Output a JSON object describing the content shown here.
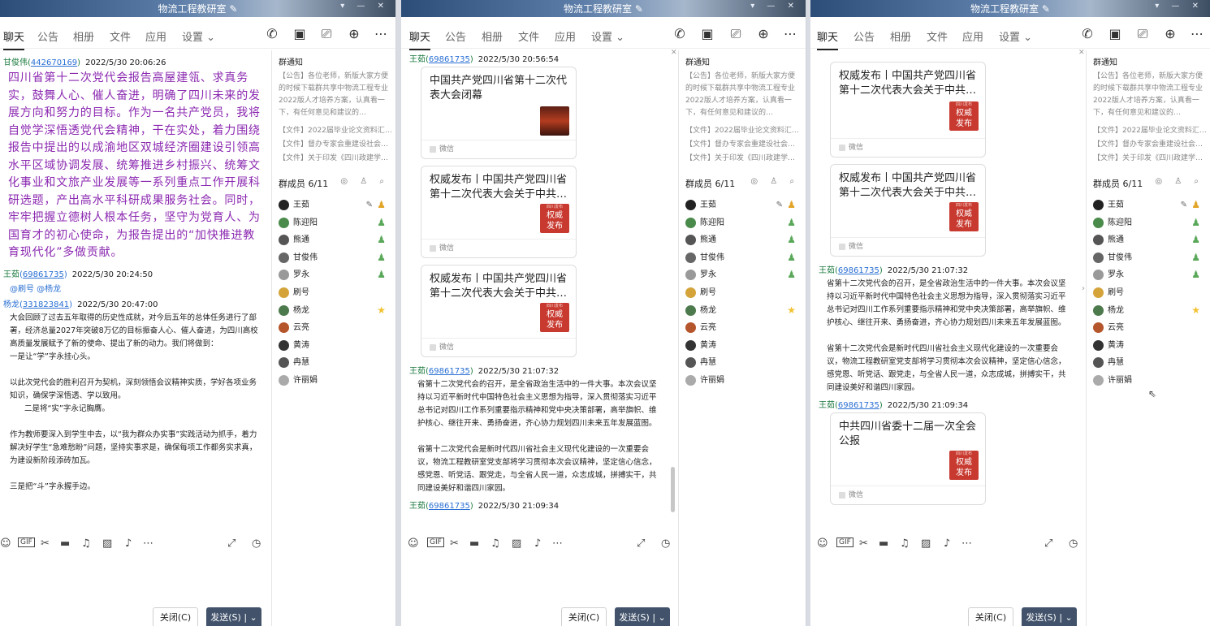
{
  "group_title": "物流工程教研室",
  "tabs": [
    "聊天",
    "公告",
    "相册",
    "文件",
    "应用",
    "设置"
  ],
  "buttons": {
    "close": "关闭(C)",
    "send": "发送(S)"
  },
  "notice": {
    "title": "群通知",
    "text": "【公告】各位老师，新版大家方便的时候下载群共享中物流工程专业2022版人才培养方案，认真看一下，有任何意见和建议的…",
    "files": [
      "【文件】2022届毕业论文资料汇…",
      "【文件】督办专家会重建设社会…",
      "【文件】关于印发《四川政建学…"
    ]
  },
  "members": {
    "title": "群成员 6/11",
    "list": [
      {
        "name": "王茹",
        "color": "#222"
      },
      {
        "name": "陈迎阳",
        "color": "#4a8a4a"
      },
      {
        "name": "熊通",
        "color": "#555"
      },
      {
        "name": "甘俊伟",
        "color": "#666"
      },
      {
        "name": "罗永",
        "color": "#999"
      },
      {
        "name": "刷号",
        "color": "#d4a43a"
      },
      {
        "name": "杨龙",
        "color": "#4d7a4d"
      },
      {
        "name": "云亮",
        "color": "#b5552c"
      },
      {
        "name": "黄涛",
        "color": "#333"
      },
      {
        "name": "冉慧",
        "color": "#555"
      },
      {
        "name": "许丽娟",
        "color": "#aaa"
      }
    ]
  },
  "w1": {
    "messages": {
      "m1_sender": "甘俊伟",
      "m1_qq": "442670169",
      "m1_time": "2022/5/30 20:06:26",
      "m1_text": "四川省第十二次党代会报告高屋建瓴、求真务实，鼓舞人心、催人奋进，明确了四川未来的发展方向和努力的目标。作为一名共产党员，我将自觉学深悟透党代会精神，干在实处，着力围绕报告中提出的以成渝地区双城经济圈建设引领高水平区域协调发展、统筹推进乡村振兴、统筹文化事业和文旅产业发展等一系列重点工作开展科研选题，产出高水平科研成果服务社会。同时，牢牢把握立德树人根本任务，坚守为党育人、为国育才的初心使命，为报告提出的“加快推进教育现代化”多做贡献。",
      "m2_sender": "王茹",
      "m2_qq": "69861735",
      "m2_time": "2022/5/30 20:24:50",
      "m2_mention": "@刷号 @杨龙",
      "m3_sender": "杨龙",
      "m3_qq": "331823841",
      "m3_time": "2022/5/30 20:47:00",
      "m3_p1": "大会回顾了过去五年取得的历史性成就，对今后五年的总体任务进行了部署，经济总量2027年突破8万亿的目标振奋人心、催人奋进，为四川高校高质量发展赋予了新的使命、提出了新的动力。我们将做到：",
      "m3_p2": "一是让“学”字永挂心头。",
      "m3_p3": "以此次党代会的胜利召开为契机，深刻领悟会议精神实质，学好各项业务知识，确保学深悟透、学以致用。",
      "m3_p4": "二是将“实”字永记胸膺。",
      "m3_p5": "作为教师要深入到学生中去，以“我为群众办实事”实践活动为抓手，着力解决好学生“急难愁盼”问题，坚持实事求是，确保每项工作都务实求真，为建设新阶段添砖加瓦。",
      "m3_p6": "三是把“斗”字永握手边。"
    }
  },
  "w2": {
    "sender": "王茹",
    "qq": "69861735",
    "time1": "2022/5/30 20:56:54",
    "cards": [
      {
        "title": "中国共产党四川省第十二次代表大会闭幕",
        "source": "微信",
        "img": "photo"
      },
      {
        "title": "权威发布丨中国共产党四川省第十二次代表大会关于中共…",
        "source": "微信",
        "img": "red"
      },
      {
        "title": "权威发布丨中国共产党四川省第十二次代表大会关于中共…",
        "source": "微信",
        "img": "red"
      }
    ],
    "time2": "2022/5/30 21:07:32",
    "p1": "省第十二次党代会的召开，是全省政治生活中的一件大事。本次会议坚持以习近平新时代中国特色社会主义思想为指导，深入贯彻落实习近平总书记对四川工作系列重要指示精神和党中央决策部署，高举旗帜、维护核心、继往开来、勇扬奋进，齐心协力规划四川未来五年发展蓝图。",
    "p2": "省第十二次党代会是新时代四川省社会主义现代化建设的一次重要会议，物流工程教研室党支部将学习贯彻本次会议精神，坚定信心信念，感党恩、听党话、跟党走，与全省人民一道，众志成城，拼搏实干，共同建设美好和谐四川家园。",
    "time3": "2022/5/30 21:09:34"
  },
  "w3": {
    "cards": [
      {
        "title": "权威发布丨中国共产党四川省第十二次代表大会关于中共…",
        "source": "微信",
        "img": "red"
      },
      {
        "title": "权威发布丨中国共产党四川省第十二次代表大会关于中共…",
        "source": "微信",
        "img": "red"
      },
      {
        "title": "中共四川省委十二届一次全会公报",
        "source": "微信",
        "img": "red"
      }
    ],
    "sender": "王茹",
    "qq": "69861735",
    "time1": "2022/5/30 21:07:32",
    "time2": "2022/5/30 21:09:34"
  },
  "red_badge": {
    "top": "四川发布",
    "line1": "权威",
    "line2": "发布"
  },
  "colors": {
    "send_button": "#41526a",
    "purple_text": "#8b28b0",
    "link_blue": "#2a6fd3",
    "green_name": "#1b7a3e"
  }
}
